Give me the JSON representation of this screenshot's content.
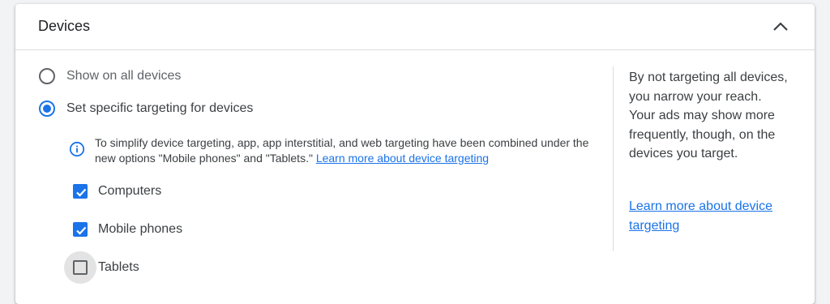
{
  "section": {
    "title": "Devices",
    "collapse_icon": "chevron-up-icon"
  },
  "targeting": {
    "options": [
      {
        "label": "Show on all devices",
        "selected": false
      },
      {
        "label": "Set specific targeting for devices",
        "selected": true
      }
    ],
    "info": {
      "icon": "info-icon",
      "text": "To simplify device targeting, app, app interstitial, and web targeting have been combined under the new options \"Mobile phones\" and \"Tablets.\" ",
      "link": "Learn more about device targeting"
    },
    "devices": [
      {
        "label": "Computers",
        "checked": true
      },
      {
        "label": "Mobile phones",
        "checked": true
      },
      {
        "label": "Tablets",
        "checked": false
      }
    ]
  },
  "side_panel": {
    "text": "By not targeting all devices, you narrow your reach. Your ads may show more frequently, though, on the devices you target.",
    "link": "Learn more about device targeting"
  },
  "colors": {
    "accent": "#1a73e8",
    "text": "#3c4043",
    "muted": "#5f6368",
    "divider": "#dadce0"
  }
}
